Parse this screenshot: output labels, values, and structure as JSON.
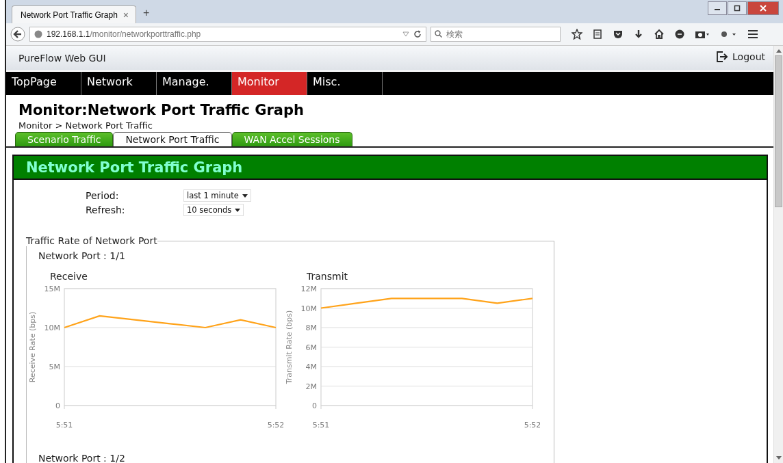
{
  "browser": {
    "tab_title": "Network Port Traffic Graph",
    "tab_close": "×",
    "new_tab": "+",
    "url_host": "192.168.1.1",
    "url_path": "/monitor/networkporttraffic.php",
    "search_placeholder": "検索"
  },
  "header": {
    "title": "PureFlow Web GUI",
    "logout": "Logout"
  },
  "nav": [
    {
      "label": "TopPage",
      "selected": false
    },
    {
      "label": "Network",
      "selected": false
    },
    {
      "label": "Manage.",
      "selected": false
    },
    {
      "label": "Monitor",
      "selected": true
    },
    {
      "label": "Misc.",
      "selected": false
    }
  ],
  "page_title": "Monitor:Network Port Traffic Graph",
  "breadcrumb": "Monitor > Network Port Traffic",
  "tabs": [
    {
      "label": "Scenario Traffic",
      "selected": false
    },
    {
      "label": "Network Port Traffic",
      "selected": true
    },
    {
      "label": "WAN Accel Sessions",
      "selected": false
    }
  ],
  "panel": {
    "title": "Network Port Traffic Graph",
    "settings": [
      {
        "label": "Period:",
        "value": "last 1 minute"
      },
      {
        "label": "Refresh:",
        "value": "10 seconds"
      }
    ],
    "group": {
      "legend": "Traffic Rate of Network Port",
      "ports": [
        {
          "name": "Network Port : 1/1",
          "charts": [
            {
              "chart_data": {
                "type": "line",
                "title": "Receive",
                "ylabel": "Receive Rate (bps)",
                "categories": [
                  "5:51",
                  null,
                  null,
                  null,
                  null,
                  null,
                  "5:52"
                ],
                "series": [
                  {
                    "color": "#ffa31a",
                    "values": [
                      10,
                      11.5,
                      11,
                      10.5,
                      10,
                      11,
                      10
                    ]
                  }
                ],
                "ylim": [
                  0,
                  15
                ],
                "grid": true,
                "yticks": [
                  {
                    "value": 0,
                    "label": "0"
                  },
                  {
                    "value": 5,
                    "label": "5M"
                  },
                  {
                    "value": 10,
                    "label": "10M"
                  },
                  {
                    "value": 15,
                    "label": "15M"
                  }
                ]
              }
            },
            {
              "chart_data": {
                "type": "line",
                "title": "Transmit",
                "ylabel": "Transmit Rate (bps)",
                "categories": [
                  "5:51",
                  null,
                  null,
                  null,
                  null,
                  null,
                  "5:52"
                ],
                "series": [
                  {
                    "color": "#ffa31a",
                    "values": [
                      10,
                      10.5,
                      11,
                      11,
                      11,
                      10.5,
                      11
                    ]
                  }
                ],
                "ylim": [
                  0,
                  12
                ],
                "grid": true,
                "yticks": [
                  {
                    "value": 0,
                    "label": "0"
                  },
                  {
                    "value": 2,
                    "label": "2M"
                  },
                  {
                    "value": 4,
                    "label": "4M"
                  },
                  {
                    "value": 6,
                    "label": "6M"
                  },
                  {
                    "value": 8,
                    "label": "8M"
                  },
                  {
                    "value": 10,
                    "label": "10M"
                  },
                  {
                    "value": 12,
                    "label": "12M"
                  }
                ]
              }
            }
          ]
        },
        {
          "name": "Network Port : 1/2"
        }
      ]
    }
  }
}
